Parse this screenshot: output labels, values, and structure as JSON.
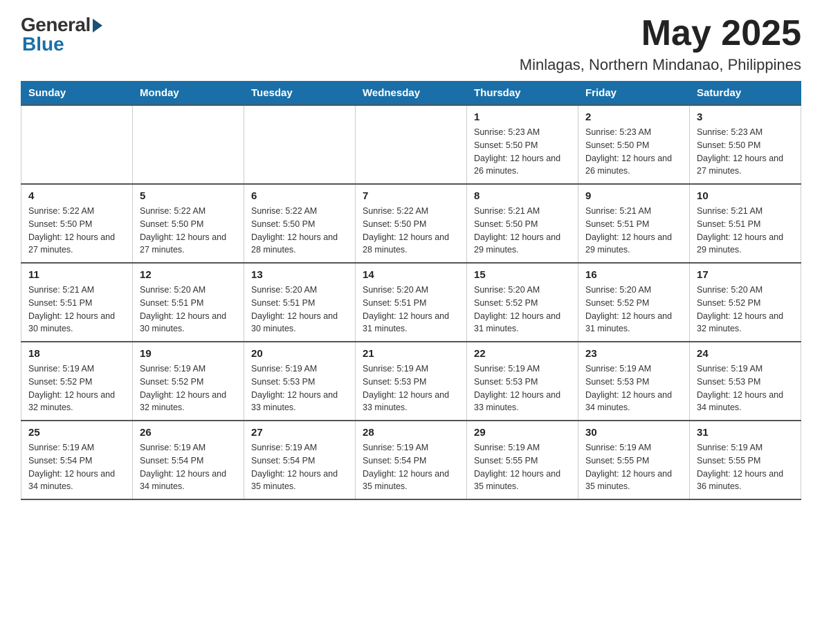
{
  "logo": {
    "general": "General",
    "blue": "Blue"
  },
  "header": {
    "month": "May 2025",
    "location": "Minlagas, Northern Mindanao, Philippines"
  },
  "weekdays": [
    "Sunday",
    "Monday",
    "Tuesday",
    "Wednesday",
    "Thursday",
    "Friday",
    "Saturday"
  ],
  "weeks": [
    [
      {
        "day": "",
        "sunrise": "",
        "sunset": "",
        "daylight": ""
      },
      {
        "day": "",
        "sunrise": "",
        "sunset": "",
        "daylight": ""
      },
      {
        "day": "",
        "sunrise": "",
        "sunset": "",
        "daylight": ""
      },
      {
        "day": "",
        "sunrise": "",
        "sunset": "",
        "daylight": ""
      },
      {
        "day": "1",
        "sunrise": "Sunrise: 5:23 AM",
        "sunset": "Sunset: 5:50 PM",
        "daylight": "Daylight: 12 hours and 26 minutes."
      },
      {
        "day": "2",
        "sunrise": "Sunrise: 5:23 AM",
        "sunset": "Sunset: 5:50 PM",
        "daylight": "Daylight: 12 hours and 26 minutes."
      },
      {
        "day": "3",
        "sunrise": "Sunrise: 5:23 AM",
        "sunset": "Sunset: 5:50 PM",
        "daylight": "Daylight: 12 hours and 27 minutes."
      }
    ],
    [
      {
        "day": "4",
        "sunrise": "Sunrise: 5:22 AM",
        "sunset": "Sunset: 5:50 PM",
        "daylight": "Daylight: 12 hours and 27 minutes."
      },
      {
        "day": "5",
        "sunrise": "Sunrise: 5:22 AM",
        "sunset": "Sunset: 5:50 PM",
        "daylight": "Daylight: 12 hours and 27 minutes."
      },
      {
        "day": "6",
        "sunrise": "Sunrise: 5:22 AM",
        "sunset": "Sunset: 5:50 PM",
        "daylight": "Daylight: 12 hours and 28 minutes."
      },
      {
        "day": "7",
        "sunrise": "Sunrise: 5:22 AM",
        "sunset": "Sunset: 5:50 PM",
        "daylight": "Daylight: 12 hours and 28 minutes."
      },
      {
        "day": "8",
        "sunrise": "Sunrise: 5:21 AM",
        "sunset": "Sunset: 5:50 PM",
        "daylight": "Daylight: 12 hours and 29 minutes."
      },
      {
        "day": "9",
        "sunrise": "Sunrise: 5:21 AM",
        "sunset": "Sunset: 5:51 PM",
        "daylight": "Daylight: 12 hours and 29 minutes."
      },
      {
        "day": "10",
        "sunrise": "Sunrise: 5:21 AM",
        "sunset": "Sunset: 5:51 PM",
        "daylight": "Daylight: 12 hours and 29 minutes."
      }
    ],
    [
      {
        "day": "11",
        "sunrise": "Sunrise: 5:21 AM",
        "sunset": "Sunset: 5:51 PM",
        "daylight": "Daylight: 12 hours and 30 minutes."
      },
      {
        "day": "12",
        "sunrise": "Sunrise: 5:20 AM",
        "sunset": "Sunset: 5:51 PM",
        "daylight": "Daylight: 12 hours and 30 minutes."
      },
      {
        "day": "13",
        "sunrise": "Sunrise: 5:20 AM",
        "sunset": "Sunset: 5:51 PM",
        "daylight": "Daylight: 12 hours and 30 minutes."
      },
      {
        "day": "14",
        "sunrise": "Sunrise: 5:20 AM",
        "sunset": "Sunset: 5:51 PM",
        "daylight": "Daylight: 12 hours and 31 minutes."
      },
      {
        "day": "15",
        "sunrise": "Sunrise: 5:20 AM",
        "sunset": "Sunset: 5:52 PM",
        "daylight": "Daylight: 12 hours and 31 minutes."
      },
      {
        "day": "16",
        "sunrise": "Sunrise: 5:20 AM",
        "sunset": "Sunset: 5:52 PM",
        "daylight": "Daylight: 12 hours and 31 minutes."
      },
      {
        "day": "17",
        "sunrise": "Sunrise: 5:20 AM",
        "sunset": "Sunset: 5:52 PM",
        "daylight": "Daylight: 12 hours and 32 minutes."
      }
    ],
    [
      {
        "day": "18",
        "sunrise": "Sunrise: 5:19 AM",
        "sunset": "Sunset: 5:52 PM",
        "daylight": "Daylight: 12 hours and 32 minutes."
      },
      {
        "day": "19",
        "sunrise": "Sunrise: 5:19 AM",
        "sunset": "Sunset: 5:52 PM",
        "daylight": "Daylight: 12 hours and 32 minutes."
      },
      {
        "day": "20",
        "sunrise": "Sunrise: 5:19 AM",
        "sunset": "Sunset: 5:53 PM",
        "daylight": "Daylight: 12 hours and 33 minutes."
      },
      {
        "day": "21",
        "sunrise": "Sunrise: 5:19 AM",
        "sunset": "Sunset: 5:53 PM",
        "daylight": "Daylight: 12 hours and 33 minutes."
      },
      {
        "day": "22",
        "sunrise": "Sunrise: 5:19 AM",
        "sunset": "Sunset: 5:53 PM",
        "daylight": "Daylight: 12 hours and 33 minutes."
      },
      {
        "day": "23",
        "sunrise": "Sunrise: 5:19 AM",
        "sunset": "Sunset: 5:53 PM",
        "daylight": "Daylight: 12 hours and 34 minutes."
      },
      {
        "day": "24",
        "sunrise": "Sunrise: 5:19 AM",
        "sunset": "Sunset: 5:53 PM",
        "daylight": "Daylight: 12 hours and 34 minutes."
      }
    ],
    [
      {
        "day": "25",
        "sunrise": "Sunrise: 5:19 AM",
        "sunset": "Sunset: 5:54 PM",
        "daylight": "Daylight: 12 hours and 34 minutes."
      },
      {
        "day": "26",
        "sunrise": "Sunrise: 5:19 AM",
        "sunset": "Sunset: 5:54 PM",
        "daylight": "Daylight: 12 hours and 34 minutes."
      },
      {
        "day": "27",
        "sunrise": "Sunrise: 5:19 AM",
        "sunset": "Sunset: 5:54 PM",
        "daylight": "Daylight: 12 hours and 35 minutes."
      },
      {
        "day": "28",
        "sunrise": "Sunrise: 5:19 AM",
        "sunset": "Sunset: 5:54 PM",
        "daylight": "Daylight: 12 hours and 35 minutes."
      },
      {
        "day": "29",
        "sunrise": "Sunrise: 5:19 AM",
        "sunset": "Sunset: 5:55 PM",
        "daylight": "Daylight: 12 hours and 35 minutes."
      },
      {
        "day": "30",
        "sunrise": "Sunrise: 5:19 AM",
        "sunset": "Sunset: 5:55 PM",
        "daylight": "Daylight: 12 hours and 35 minutes."
      },
      {
        "day": "31",
        "sunrise": "Sunrise: 5:19 AM",
        "sunset": "Sunset: 5:55 PM",
        "daylight": "Daylight: 12 hours and 36 minutes."
      }
    ]
  ]
}
